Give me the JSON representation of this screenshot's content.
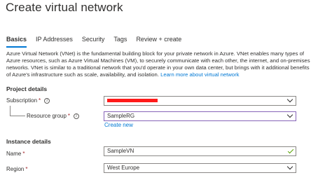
{
  "header": {
    "title": "Create virtual network",
    "more": "···"
  },
  "tabs": [
    {
      "label": "Basics"
    },
    {
      "label": "IP Addresses"
    },
    {
      "label": "Security"
    },
    {
      "label": "Tags"
    },
    {
      "label": "Review + create"
    }
  ],
  "description": {
    "text": "Azure Virtual Network (VNet) is the fundamental building block for your private network in Azure. VNet enables many types of Azure resources, such as Azure Virtual Machines (VM), to securely communicate with each other, the internet, and on-premises networks. VNet is similar to a traditional network that you'd operate in your own data center, but brings with it additional benefits of Azure's infrastructure such as scale, availability, and isolation.",
    "link": "Learn more about virtual network"
  },
  "project_details": {
    "heading": "Project details",
    "subscription_label": "Subscription",
    "resource_group_label": "Resource group",
    "resource_group_value": "SampleRG",
    "create_new": "Create new"
  },
  "instance_details": {
    "heading": "Instance details",
    "name_label": "Name",
    "name_value": "SampleVN",
    "region_label": "Region",
    "region_value": "West Europe"
  },
  "required_marker": "*",
  "colors": {
    "accent": "#0078d4",
    "required": "#a4262c",
    "focus_border": "#8764b8",
    "valid": "#57a300",
    "redaction": "#ff1a1a"
  }
}
